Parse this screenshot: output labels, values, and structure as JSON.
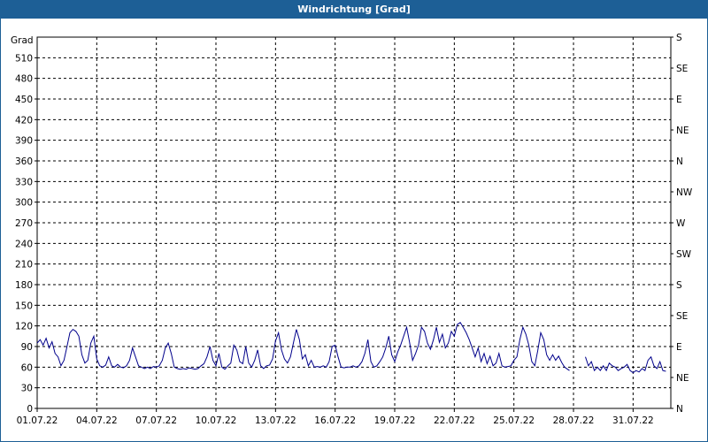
{
  "window": {
    "title": "Windrichtung [Grad]"
  },
  "chart_data": {
    "type": "line",
    "title": "Windrichtung [Grad]",
    "ylabel": "Grad",
    "xlabel": "",
    "ylim": [
      0,
      540
    ],
    "y_ticks": [
      0,
      30,
      60,
      90,
      120,
      150,
      180,
      210,
      240,
      270,
      300,
      330,
      360,
      390,
      420,
      450,
      480,
      510
    ],
    "x_tick_labels": [
      "01.07.22",
      "04.07.22",
      "07.07.22",
      "10.07.22",
      "13.07.22",
      "16.07.22",
      "19.07.22",
      "22.07.22",
      "25.07.22",
      "28.07.22",
      "31.07.22"
    ],
    "x_tick_days": [
      0,
      3,
      6,
      9,
      12,
      15,
      18,
      21,
      24,
      27,
      30
    ],
    "right_axis_labels": [
      {
        "deg": 0,
        "label": "N"
      },
      {
        "deg": 45,
        "label": "NE"
      },
      {
        "deg": 90,
        "label": "E"
      },
      {
        "deg": 135,
        "label": "SE"
      },
      {
        "deg": 180,
        "label": "S"
      },
      {
        "deg": 225,
        "label": "SW"
      },
      {
        "deg": 270,
        "label": "W"
      },
      {
        "deg": 315,
        "label": "NW"
      },
      {
        "deg": 360,
        "label": "N"
      },
      {
        "deg": 405,
        "label": "NE"
      },
      {
        "deg": 450,
        "label": "E"
      },
      {
        "deg": 495,
        "label": "SE"
      },
      {
        "deg": 540,
        "label": "S"
      }
    ],
    "grid": true,
    "line_color": "#00008b",
    "series": [
      {
        "segments": [
          [
            [
              0.0,
              95
            ],
            [
              0.15,
              100
            ],
            [
              0.3,
              92
            ],
            [
              0.45,
              102
            ],
            [
              0.6,
              88
            ],
            [
              0.75,
              97
            ],
            [
              0.9,
              80
            ],
            [
              1.05,
              75
            ],
            [
              1.2,
              62
            ],
            [
              1.35,
              70
            ],
            [
              1.5,
              90
            ],
            [
              1.65,
              110
            ],
            [
              1.8,
              115
            ],
            [
              1.95,
              112
            ],
            [
              2.1,
              105
            ],
            [
              2.25,
              78
            ],
            [
              2.4,
              66
            ],
            [
              2.55,
              70
            ],
            [
              2.7,
              95
            ],
            [
              2.85,
              105
            ],
            [
              3.0,
              72
            ],
            [
              3.15,
              62
            ],
            [
              3.3,
              60
            ],
            [
              3.45,
              63
            ],
            [
              3.6,
              75
            ],
            [
              3.75,
              62
            ],
            [
              3.9,
              60
            ],
            [
              4.05,
              64
            ],
            [
              4.2,
              60
            ],
            [
              4.35,
              59
            ],
            [
              4.5,
              62
            ],
            [
              4.65,
              70
            ],
            [
              4.8,
              88
            ],
            [
              4.95,
              75
            ],
            [
              5.1,
              62
            ],
            [
              5.25,
              60
            ],
            [
              5.4,
              58
            ],
            [
              5.55,
              60
            ],
            [
              5.7,
              58
            ],
            [
              5.85,
              61
            ],
            [
              6.0,
              60
            ],
            [
              6.15,
              62
            ],
            [
              6.3,
              70
            ],
            [
              6.45,
              88
            ],
            [
              6.6,
              95
            ],
            [
              6.75,
              80
            ],
            [
              6.9,
              60
            ],
            [
              7.05,
              58
            ],
            [
              7.2,
              57
            ],
            [
              7.35,
              58
            ],
            [
              7.5,
              57
            ],
            [
              7.65,
              59
            ],
            [
              7.8,
              58
            ],
            [
              7.95,
              57
            ],
            [
              8.1,
              58
            ],
            [
              8.25,
              62
            ],
            [
              8.4,
              65
            ],
            [
              8.55,
              75
            ],
            [
              8.7,
              90
            ],
            [
              8.85,
              70
            ],
            [
              9.0,
              62
            ],
            [
              9.15,
              80
            ],
            [
              9.3,
              60
            ],
            [
              9.45,
              57
            ],
            [
              9.6,
              62
            ],
            [
              9.75,
              66
            ],
            [
              9.9,
              92
            ],
            [
              10.05,
              85
            ],
            [
              10.2,
              68
            ],
            [
              10.35,
              65
            ],
            [
              10.5,
              90
            ],
            [
              10.65,
              66
            ],
            [
              10.8,
              60
            ],
            [
              10.95,
              70
            ],
            [
              11.1,
              85
            ],
            [
              11.25,
              62
            ],
            [
              11.4,
              58
            ],
            [
              11.55,
              62
            ],
            [
              11.7,
              63
            ],
            [
              11.85,
              72
            ],
            [
              12.0,
              98
            ],
            [
              12.15,
              110
            ],
            [
              12.3,
              85
            ],
            [
              12.45,
              72
            ],
            [
              12.6,
              66
            ],
            [
              12.75,
              75
            ],
            [
              12.9,
              95
            ],
            [
              13.05,
              115
            ],
            [
              13.2,
              100
            ],
            [
              13.35,
              72
            ],
            [
              13.5,
              78
            ],
            [
              13.65,
              62
            ],
            [
              13.8,
              70
            ],
            [
              13.95,
              60
            ],
            [
              14.1,
              61
            ],
            [
              14.25,
              60
            ],
            [
              14.4,
              62
            ],
            [
              14.55,
              60
            ],
            [
              14.7,
              68
            ],
            [
              14.85,
              90
            ],
            [
              15.0,
              92
            ],
            [
              15.15,
              75
            ],
            [
              15.3,
              60
            ],
            [
              15.45,
              59
            ],
            [
              15.6,
              60
            ],
            [
              15.75,
              60
            ],
            [
              15.9,
              62
            ],
            [
              16.05,
              60
            ],
            [
              16.2,
              62
            ],
            [
              16.35,
              68
            ],
            [
              16.5,
              80
            ],
            [
              16.65,
              100
            ],
            [
              16.8,
              68
            ],
            [
              16.95,
              60
            ],
            [
              17.1,
              62
            ],
            [
              17.25,
              68
            ],
            [
              17.4,
              75
            ],
            [
              17.55,
              88
            ],
            [
              17.7,
              105
            ],
            [
              17.85,
              78
            ],
            [
              18.0,
              68
            ],
            [
              18.15,
              82
            ],
            [
              18.3,
              92
            ],
            [
              18.45,
              105
            ],
            [
              18.6,
              118
            ],
            [
              18.75,
              96
            ],
            [
              18.9,
              70
            ],
            [
              19.05,
              80
            ],
            [
              19.2,
              92
            ],
            [
              19.35,
              118
            ],
            [
              19.5,
              112
            ],
            [
              19.65,
              95
            ],
            [
              19.8,
              86
            ],
            [
              19.95,
              100
            ],
            [
              20.1,
              118
            ],
            [
              20.25,
              96
            ],
            [
              20.4,
              108
            ],
            [
              20.55,
              88
            ],
            [
              20.7,
              95
            ],
            [
              20.85,
              112
            ],
            [
              21.0,
              105
            ],
            [
              21.15,
              122
            ],
            [
              21.3,
              125
            ],
            [
              21.45,
              118
            ],
            [
              21.6,
              110
            ],
            [
              21.75,
              100
            ],
            [
              21.9,
              88
            ],
            [
              22.05,
              75
            ],
            [
              22.2,
              88
            ],
            [
              22.35,
              68
            ],
            [
              22.5,
              80
            ],
            [
              22.65,
              65
            ],
            [
              22.8,
              76
            ],
            [
              22.95,
              62
            ],
            [
              23.1,
              66
            ],
            [
              23.25,
              80
            ],
            [
              23.4,
              62
            ],
            [
              23.55,
              60
            ],
            [
              23.7,
              61
            ],
            [
              23.85,
              62
            ],
            [
              24.0,
              70
            ],
            [
              24.15,
              75
            ],
            [
              24.3,
              100
            ],
            [
              24.45,
              118
            ],
            [
              24.6,
              108
            ],
            [
              24.75,
              92
            ],
            [
              24.9,
              68
            ],
            [
              25.05,
              62
            ],
            [
              25.2,
              84
            ],
            [
              25.35,
              110
            ],
            [
              25.5,
              100
            ],
            [
              25.65,
              78
            ],
            [
              25.8,
              70
            ],
            [
              25.95,
              78
            ],
            [
              26.1,
              70
            ],
            [
              26.25,
              76
            ],
            [
              26.4,
              67
            ],
            [
              26.55,
              60
            ],
            [
              26.7,
              57
            ],
            [
              26.8,
              55
            ]
          ],
          [
            [
              27.6,
              75
            ],
            [
              27.75,
              62
            ],
            [
              27.9,
              68
            ],
            [
              28.05,
              55
            ],
            [
              28.2,
              60
            ],
            [
              28.35,
              55
            ],
            [
              28.5,
              62
            ],
            [
              28.65,
              55
            ],
            [
              28.8,
              66
            ],
            [
              28.95,
              62
            ],
            [
              29.1,
              60
            ],
            [
              29.25,
              55
            ],
            [
              29.4,
              58
            ],
            [
              29.55,
              60
            ],
            [
              29.7,
              64
            ],
            [
              29.85,
              55
            ],
            [
              30.0,
              52
            ],
            [
              30.15,
              55
            ],
            [
              30.3,
              53
            ],
            [
              30.45,
              58
            ],
            [
              30.6,
              55
            ],
            [
              30.75,
              70
            ],
            [
              30.9,
              75
            ],
            [
              31.05,
              62
            ],
            [
              31.2,
              58
            ],
            [
              31.35,
              68
            ],
            [
              31.5,
              55
            ],
            [
              31.65,
              54
            ]
          ]
        ]
      }
    ]
  }
}
